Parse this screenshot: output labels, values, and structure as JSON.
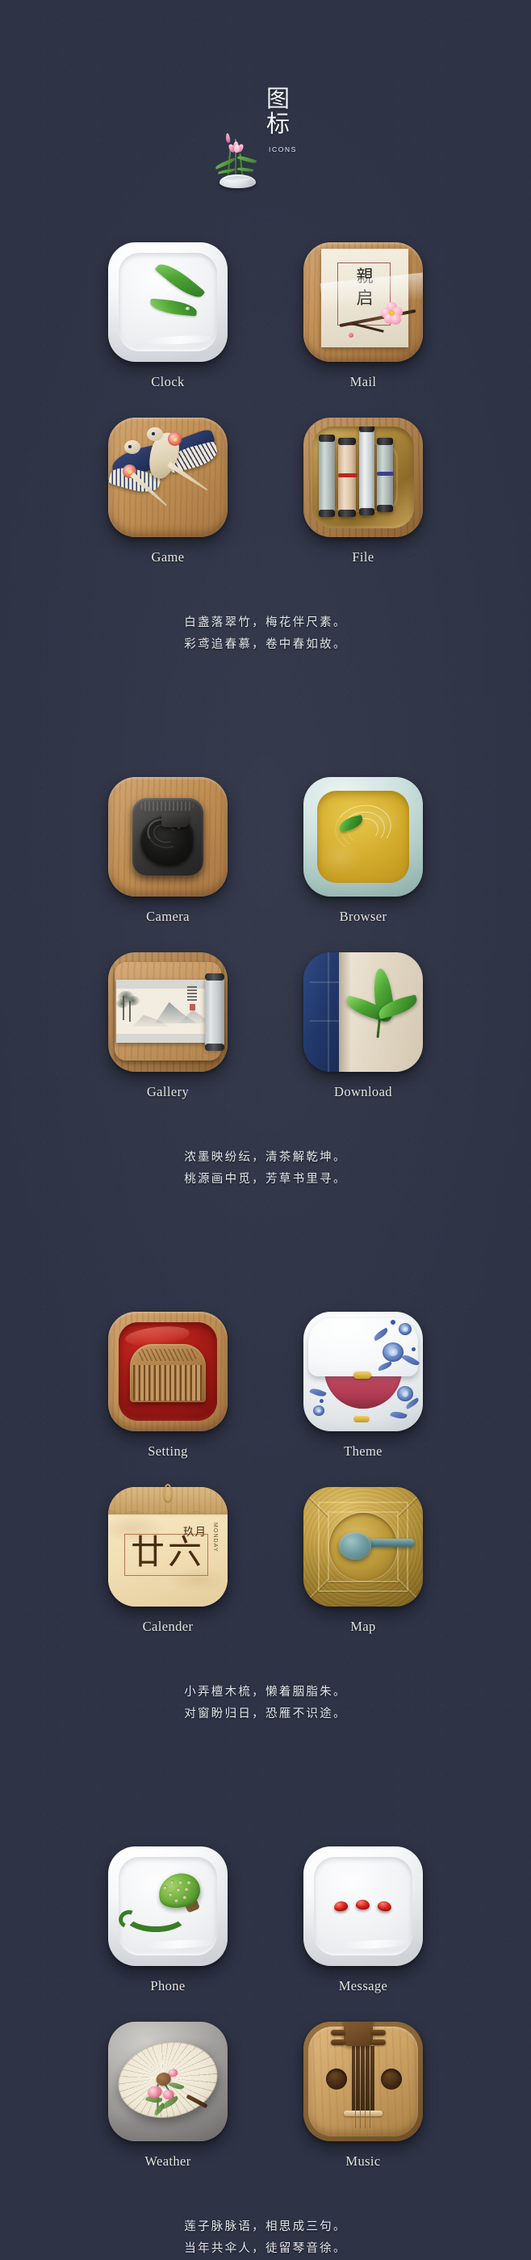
{
  "header": {
    "title": "图\n标",
    "subtitle": "ICONS",
    "logo_icon": "lotus-ikebana-vase"
  },
  "theme": {
    "background": "#2e3346",
    "label_color": "#e9e6df",
    "poem_color": "#e4e5ea"
  },
  "groups": [
    {
      "id": "group-1",
      "icons": [
        {
          "label": "Clock",
          "icon": "white-ceramic-dish-bamboo-leaf"
        },
        {
          "label": "Mail",
          "icon": "wood-tray-letter-plum-blossom",
          "letter_text": "親\n启"
        },
        {
          "label": "Game",
          "icon": "wood-board-swallow-kite"
        },
        {
          "label": "File",
          "icon": "brass-tray-paper-scrolls"
        }
      ],
      "poem": [
        "白盏落翠竹，梅花伴尺素。",
        "彩鸢追春慕，卷中春如故。"
      ]
    },
    {
      "id": "group-2",
      "icons": [
        {
          "label": "Camera",
          "icon": "wood-tile-ink-stone-shutter"
        },
        {
          "label": "Browser",
          "icon": "celadon-bowl-tea-leaf-ripples"
        },
        {
          "label": "Gallery",
          "icon": "wood-board-landscape-scroll-painting"
        },
        {
          "label": "Download",
          "icon": "blue-thread-bound-book-bamboo"
        }
      ],
      "poem": [
        "浓墨映纷纭，清茶解乾坤。",
        "桃源画中觅，芳草书里寻。"
      ]
    },
    {
      "id": "group-3",
      "icons": [
        {
          "label": "Setting",
          "icon": "red-lacquer-box-wooden-comb"
        },
        {
          "label": "Theme",
          "icon": "blue-white-porcelain-rouge-box"
        },
        {
          "label": "Calender",
          "icon": "tear-off-paper-calendar",
          "calendar": {
            "month": "玖月",
            "weekday": "MONDAY",
            "day": "廿六"
          }
        },
        {
          "label": "Map",
          "icon": "bronze-sinan-compass-spoon"
        }
      ],
      "poem": [
        "小弄檀木梳，懒着胭脂朱。",
        "对窗盼归日，恐雁不识途。"
      ]
    },
    {
      "id": "group-4",
      "icons": [
        {
          "label": "Phone",
          "icon": "white-dish-lotus-seed-pod"
        },
        {
          "label": "Message",
          "icon": "white-dish-three-red-beans"
        },
        {
          "label": "Weather",
          "icon": "stone-tile-oil-paper-umbrella"
        },
        {
          "label": "Music",
          "icon": "wooden-pipa-lute"
        }
      ],
      "poem": [
        "莲子脉脉语，相思成三句。",
        "当年共伞人，徒留琴音徐。"
      ]
    }
  ]
}
